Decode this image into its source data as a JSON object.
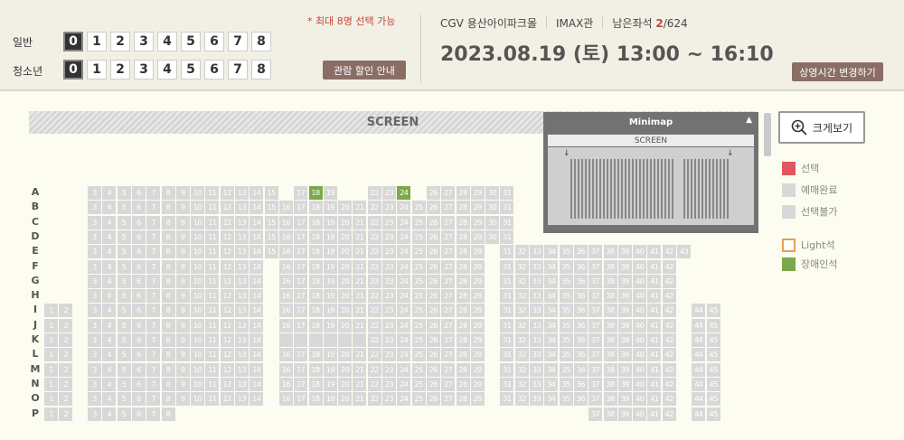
{
  "counts": {
    "general_label": "일반",
    "youth_label": "청소년",
    "options": [
      "0",
      "1",
      "2",
      "3",
      "4",
      "5",
      "6",
      "7",
      "8"
    ],
    "general_selected": "0",
    "youth_selected": "0"
  },
  "max_note": "* 최대 8명 선택 가능",
  "discount_button": "관람 할인 안내",
  "theater": "CGV 용산아이파크몰",
  "hall": "IMAX관",
  "remain_label": "남은좌석",
  "remain_count": "2",
  "remain_total": "/624",
  "datetime": "2023.08.19 (토) 13:00 ~ 16:10",
  "change_time_button": "상영시간 변경하기",
  "screen_label": "SCREEN",
  "minimap": {
    "title": "Minimap",
    "screen": "SCREEN"
  },
  "zoom_button": "크게보기",
  "legend": [
    {
      "label": "선택",
      "color": "#e0575f",
      "type": "solid"
    },
    {
      "label": "예매완료",
      "color": "#d8d8d8",
      "type": "solid"
    },
    {
      "label": "선택불가",
      "color": "#d8d8d8",
      "type": "cross"
    },
    {
      "label": "Light석",
      "color": "#e8a14a",
      "type": "outline"
    },
    {
      "label": "장애인석",
      "color": "#7aa84a",
      "type": "solid"
    }
  ],
  "seat_rows": [
    {
      "row": "A",
      "blocks": [
        [
          3,
          15
        ],
        [
          17,
          19
        ],
        [
          22,
          24
        ],
        [
          26,
          31
        ]
      ],
      "accessible": [
        18,
        24
      ]
    },
    {
      "row": "B",
      "blocks": [
        [
          3,
          15
        ],
        [
          16,
          30
        ],
        [
          31,
          31
        ]
      ]
    },
    {
      "row": "C",
      "blocks": [
        [
          3,
          15
        ],
        [
          16,
          30
        ],
        [
          31,
          31
        ]
      ]
    },
    {
      "row": "D",
      "blocks": [
        [
          3,
          15
        ],
        [
          16,
          30
        ],
        [
          31,
          31
        ]
      ]
    },
    {
      "row": "E",
      "blocks": [
        [
          3,
          15
        ],
        [
          16,
          29
        ],
        [
          31,
          43
        ]
      ]
    },
    {
      "row": "F",
      "blocks": [
        [
          3,
          14
        ],
        [
          16,
          29
        ],
        [
          31,
          42
        ]
      ]
    },
    {
      "row": "G",
      "blocks": [
        [
          3,
          14
        ],
        [
          16,
          29
        ],
        [
          31,
          42
        ]
      ]
    },
    {
      "row": "H",
      "blocks": [
        [
          3,
          14
        ],
        [
          16,
          29
        ],
        [
          31,
          42
        ]
      ]
    },
    {
      "row": "I",
      "blocks": [
        [
          1,
          2
        ],
        [
          3,
          14
        ],
        [
          16,
          29
        ],
        [
          31,
          42
        ],
        [
          44,
          45
        ]
      ]
    },
    {
      "row": "J",
      "blocks": [
        [
          1,
          2
        ],
        [
          3,
          14
        ],
        [
          16,
          29
        ],
        [
          31,
          42
        ],
        [
          44,
          45
        ]
      ]
    },
    {
      "row": "K",
      "blocks": [
        [
          1,
          2
        ],
        [
          3,
          14
        ],
        [
          16,
          29
        ],
        [
          31,
          42
        ],
        [
          44,
          45
        ]
      ],
      "unavailable": [
        16,
        17,
        18,
        19,
        20,
        21
      ]
    },
    {
      "row": "L",
      "blocks": [
        [
          1,
          2
        ],
        [
          3,
          14
        ],
        [
          16,
          29
        ],
        [
          31,
          42
        ],
        [
          44,
          45
        ]
      ]
    },
    {
      "row": "M",
      "blocks": [
        [
          1,
          2
        ],
        [
          3,
          14
        ],
        [
          16,
          29
        ],
        [
          31,
          42
        ],
        [
          44,
          45
        ]
      ]
    },
    {
      "row": "N",
      "blocks": [
        [
          1,
          2
        ],
        [
          3,
          14
        ],
        [
          16,
          29
        ],
        [
          31,
          42
        ],
        [
          44,
          45
        ]
      ]
    },
    {
      "row": "O",
      "blocks": [
        [
          1,
          2
        ],
        [
          3,
          14
        ],
        [
          16,
          29
        ],
        [
          31,
          42
        ],
        [
          44,
          45
        ]
      ]
    },
    {
      "row": "P",
      "blocks": [
        [
          1,
          2
        ],
        [
          3,
          8
        ],
        [
          37,
          42
        ],
        [
          44,
          45
        ]
      ]
    }
  ]
}
